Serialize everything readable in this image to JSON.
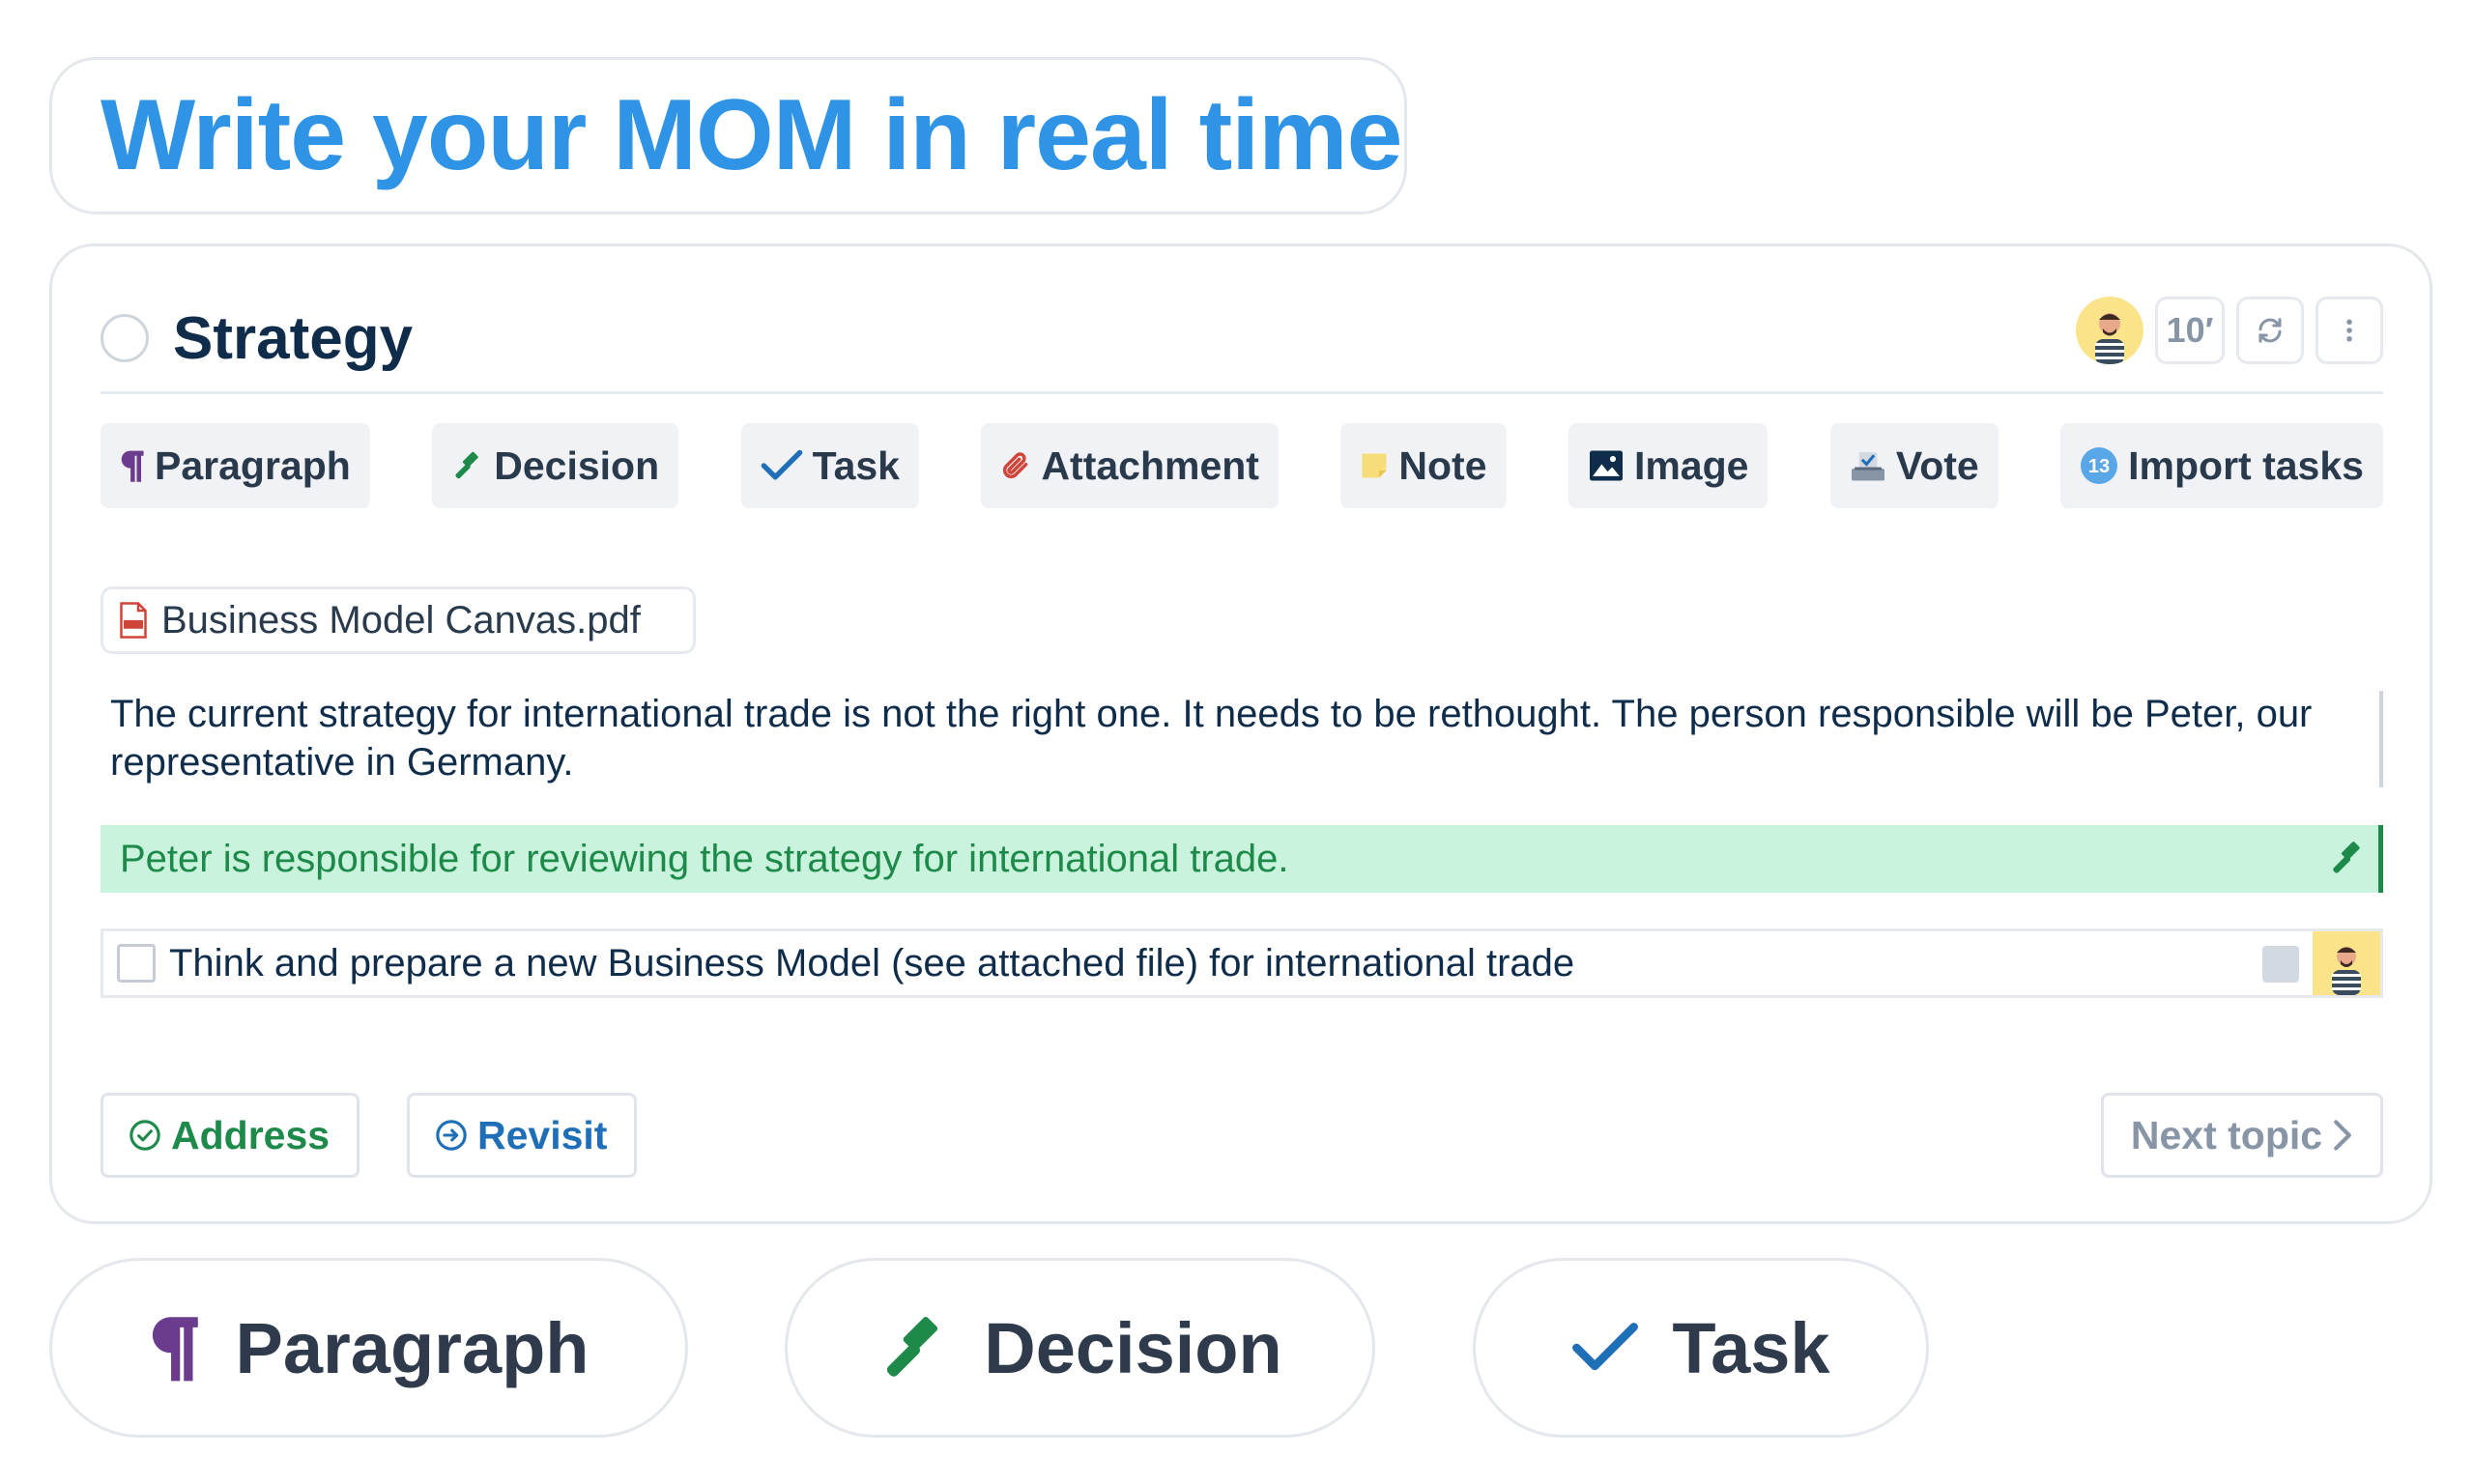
{
  "hero": {
    "title": "Write your MOM in real time"
  },
  "topic": {
    "title": "Strategy",
    "duration": "10′",
    "refresh_icon": "refresh-icon",
    "menu_icon": "more-vertical-icon"
  },
  "toolbar": {
    "items": [
      {
        "label": "Paragraph",
        "icon": "paragraph-icon",
        "color": "#6b3b8e"
      },
      {
        "label": "Decision",
        "icon": "gavel-icon",
        "color": "#1d8a4a"
      },
      {
        "label": "Task",
        "icon": "check-icon",
        "color": "#1f6fb8"
      },
      {
        "label": "Attachment",
        "icon": "paperclip-icon",
        "color": "#d0453a"
      },
      {
        "label": "Note",
        "icon": "sticky-note-icon",
        "color": "#f7dc7a"
      },
      {
        "label": "Image",
        "icon": "image-icon",
        "color": "#0f2d4a"
      },
      {
        "label": "Vote",
        "icon": "ballot-box-icon",
        "color": "#8795a6"
      },
      {
        "label": "Import tasks",
        "icon": "import-badge-icon",
        "badge": "13",
        "color": "#5aa7e8"
      }
    ]
  },
  "attachment": {
    "filename": "Business Model Canvas.pdf",
    "icon": "pdf-file-icon"
  },
  "paragraph": {
    "text": "The current strategy for international trade is not the right one. It needs to be rethought. The person responsible will be Peter, our representative in Germany."
  },
  "decision": {
    "text": "Peter is responsible for reviewing the strategy for international trade."
  },
  "task": {
    "text": "Think and prepare a new Business Model (see attached file) for international trade"
  },
  "footer": {
    "address_label": "Address",
    "revisit_label": "Revisit",
    "next_label": "Next topic"
  },
  "pills": {
    "paragraph_label": "Paragraph",
    "decision_label": "Decision",
    "task_label": "Task"
  }
}
